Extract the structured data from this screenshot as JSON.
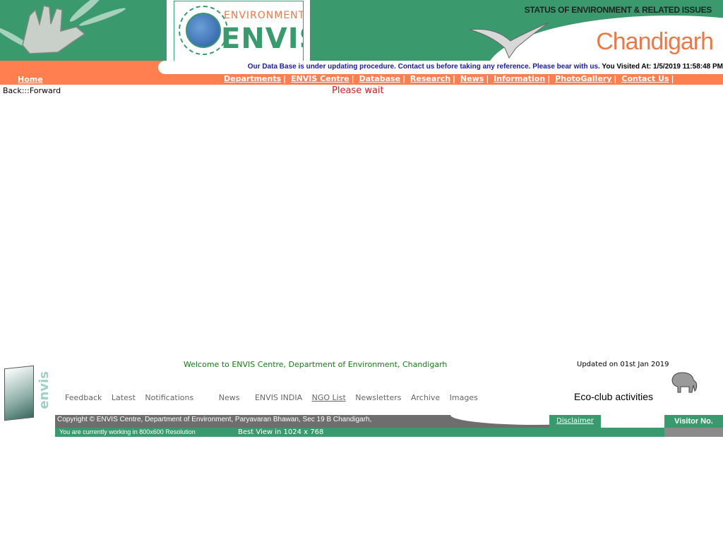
{
  "header": {
    "logo_environment": "ENVIRONMENT I",
    "logo_envis": "ENVIS-",
    "status_title": "STATUS OF ENVIRONMENT & RELATED ISSUES",
    "city": "Chandigarh"
  },
  "notice": {
    "message": "Our Data Base is under updating procedure. Contact us before taking any reference. Please bear with us.",
    "visited_label": "You Visited At:",
    "visited_value": "1/5/2019 11:58:48 PM"
  },
  "nav": {
    "home": "Home",
    "items": [
      "Departments",
      "ENVIS Centre",
      "Database",
      "Research",
      "News",
      "Information",
      "PhotoGallery",
      "Contact Us"
    ]
  },
  "main": {
    "backforward": "Back:::Forward",
    "please_wait": "Please wait"
  },
  "footer": {
    "welcome": "Welcome to ENVIS Centre, Department of Environment, Chandigarh",
    "updated": "Updated on 01st Jan 2019",
    "links": [
      "Feedback",
      "Latest",
      "Notifications",
      "News",
      "ENVIS INDIA",
      "NGO List",
      "Newsletters",
      "Archive",
      "Images"
    ],
    "eco_club": "Eco-club activities",
    "copyright": "Copyright © ENVIS Centre, Department of Environment, Paryavaran Bhawan, Sec 19 B Chandigarh,",
    "resolution": "You are currently working in 800x600 Resolution",
    "best_view": "Best View in 1024 x 768",
    "disclaimer": "Disclaimer",
    "visitor": "Visitor No.",
    "cd_label": "envis"
  },
  "colors": {
    "green": "#3a9a6e",
    "orange": "#ff7f50",
    "notice_blue": "#1a1aa8",
    "wait_red": "#cc2222"
  }
}
